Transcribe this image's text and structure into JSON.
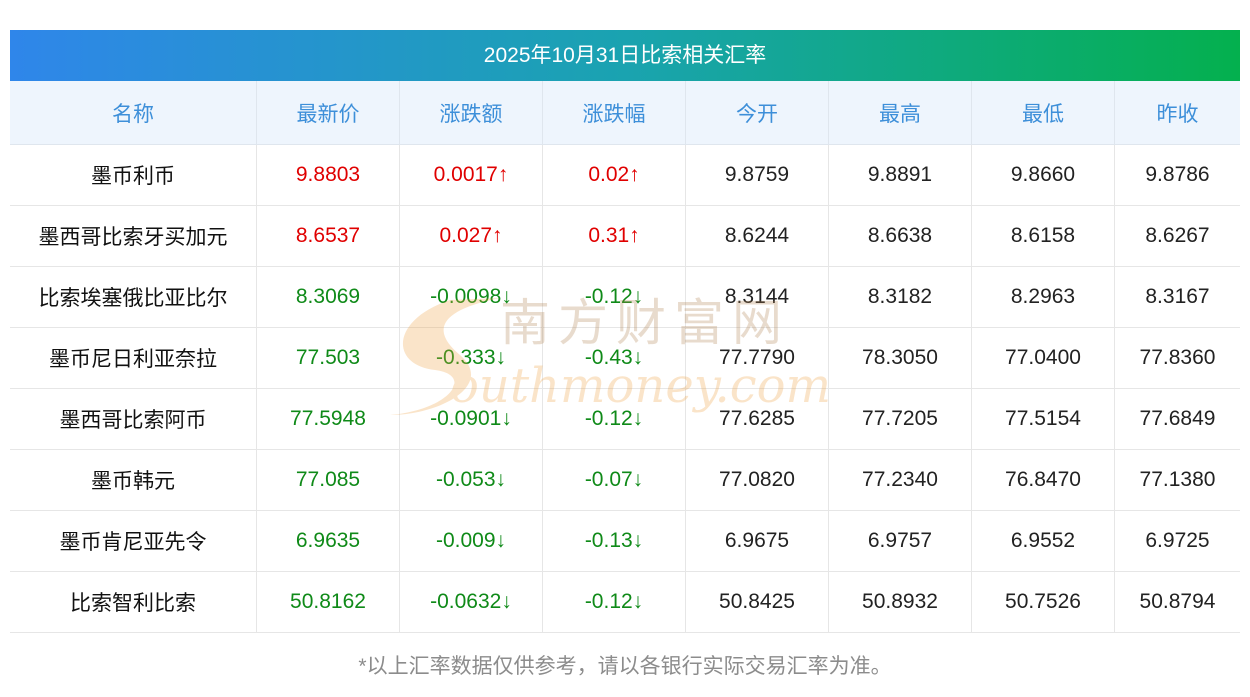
{
  "title": "2025年10月31日比索相关汇率",
  "headers": [
    "名称",
    "最新价",
    "涨跌额",
    "涨跌幅",
    "今开",
    "最高",
    "最低",
    "昨收"
  ],
  "rows": [
    {
      "name": "墨币利币",
      "latest": "9.8803",
      "change": "0.0017↑",
      "pct": "0.02↑",
      "open": "9.8759",
      "high": "9.8891",
      "low": "9.8660",
      "prev": "9.8786",
      "dir": "up"
    },
    {
      "name": "墨西哥比索牙买加元",
      "latest": "8.6537",
      "change": "0.027↑",
      "pct": "0.31↑",
      "open": "8.6244",
      "high": "8.6638",
      "low": "8.6158",
      "prev": "8.6267",
      "dir": "up"
    },
    {
      "name": "比索埃塞俄比亚比尔",
      "latest": "8.3069",
      "change": "-0.0098↓",
      "pct": "-0.12↓",
      "open": "8.3144",
      "high": "8.3182",
      "low": "8.2963",
      "prev": "8.3167",
      "dir": "down"
    },
    {
      "name": "墨币尼日利亚奈拉",
      "latest": "77.503",
      "change": "-0.333↓",
      "pct": "-0.43↓",
      "open": "77.7790",
      "high": "78.3050",
      "low": "77.0400",
      "prev": "77.8360",
      "dir": "down"
    },
    {
      "name": "墨西哥比索阿币",
      "latest": "77.5948",
      "change": "-0.0901↓",
      "pct": "-0.12↓",
      "open": "77.6285",
      "high": "77.7205",
      "low": "77.5154",
      "prev": "77.6849",
      "dir": "down"
    },
    {
      "name": "墨币韩元",
      "latest": "77.085",
      "change": "-0.053↓",
      "pct": "-0.07↓",
      "open": "77.0820",
      "high": "77.2340",
      "low": "76.8470",
      "prev": "77.1380",
      "dir": "down"
    },
    {
      "name": "墨币肯尼亚先令",
      "latest": "6.9635",
      "change": "-0.009↓",
      "pct": "-0.13↓",
      "open": "6.9675",
      "high": "6.9757",
      "low": "6.9552",
      "prev": "6.9725",
      "dir": "down"
    },
    {
      "name": "比索智利比索",
      "latest": "50.8162",
      "change": "-0.0632↓",
      "pct": "-0.12↓",
      "open": "50.8425",
      "high": "50.8932",
      "low": "50.7526",
      "prev": "50.8794",
      "dir": "down"
    }
  ],
  "note": "*以上汇率数据仅供参考，请以各银行实际交易汇率为准。",
  "watermark": {
    "cn": "南方财富网",
    "en": "outhmoney.com"
  },
  "colors": {
    "up": "#e00000",
    "down": "#0f8a18",
    "header_text": "#3d8fd9",
    "header_bg": "#eef5fd"
  }
}
